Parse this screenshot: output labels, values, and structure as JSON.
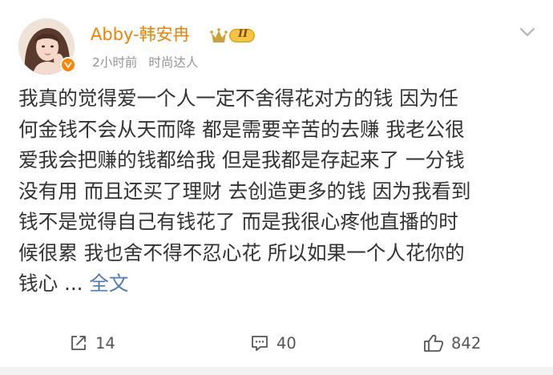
{
  "author": {
    "name": "Abby-韩安冉",
    "time_ago": "2小时前",
    "tag": "时尚达人",
    "level_badge_text": "II"
  },
  "post": {
    "lines": [
      "我真的觉得爱一个人一定不舍得花对方的钱 因为任",
      "何金钱不会从天而降 都是需要辛苦的去赚 我老公很",
      "爱我会把赚的钱都给我 但是我都是存起来了 一分钱",
      "没有用 而且还买了理财 去创造更多的钱 因为我看到",
      "钱不是觉得自己有钱花了 而是我很心疼他直播的时",
      "候很累 我也舍不得不忍心花 所以如果一个人花你的"
    ],
    "last_line_text": "钱心 ... ",
    "full_text_label": "全文"
  },
  "actions": {
    "share_count": "14",
    "comment_count": "40",
    "like_count": "842"
  },
  "colors": {
    "author_name": "#f08200",
    "link": "#4f7ab3",
    "meta": "#939393"
  },
  "icons": {
    "share": "share-icon",
    "comment": "comment-icon",
    "like": "like-icon",
    "more": "chevron-down-icon",
    "verified": "verified-icon"
  }
}
